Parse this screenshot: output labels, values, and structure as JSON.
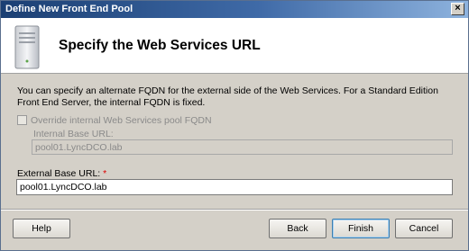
{
  "window": {
    "title": "Define New Front End Pool",
    "close_glyph": "×"
  },
  "header": {
    "icon": "server-icon",
    "title": "Specify the Web Services URL"
  },
  "content": {
    "description": "You can specify an alternate FQDN for the external side of the Web Services.  For a Standard Edition Front End Server, the internal FQDN is fixed.",
    "override_checkbox": {
      "label": "Override internal Web Services pool FQDN",
      "checked": false,
      "enabled": false
    },
    "internal_url": {
      "label": "Internal Base URL:",
      "value": "pool01.LyncDCO.lab"
    },
    "external_url": {
      "label": "External Base URL:",
      "required_marker": "*",
      "value": "pool01.LyncDCO.lab"
    }
  },
  "buttons": {
    "help": "Help",
    "back": "Back",
    "finish": "Finish",
    "cancel": "Cancel"
  }
}
